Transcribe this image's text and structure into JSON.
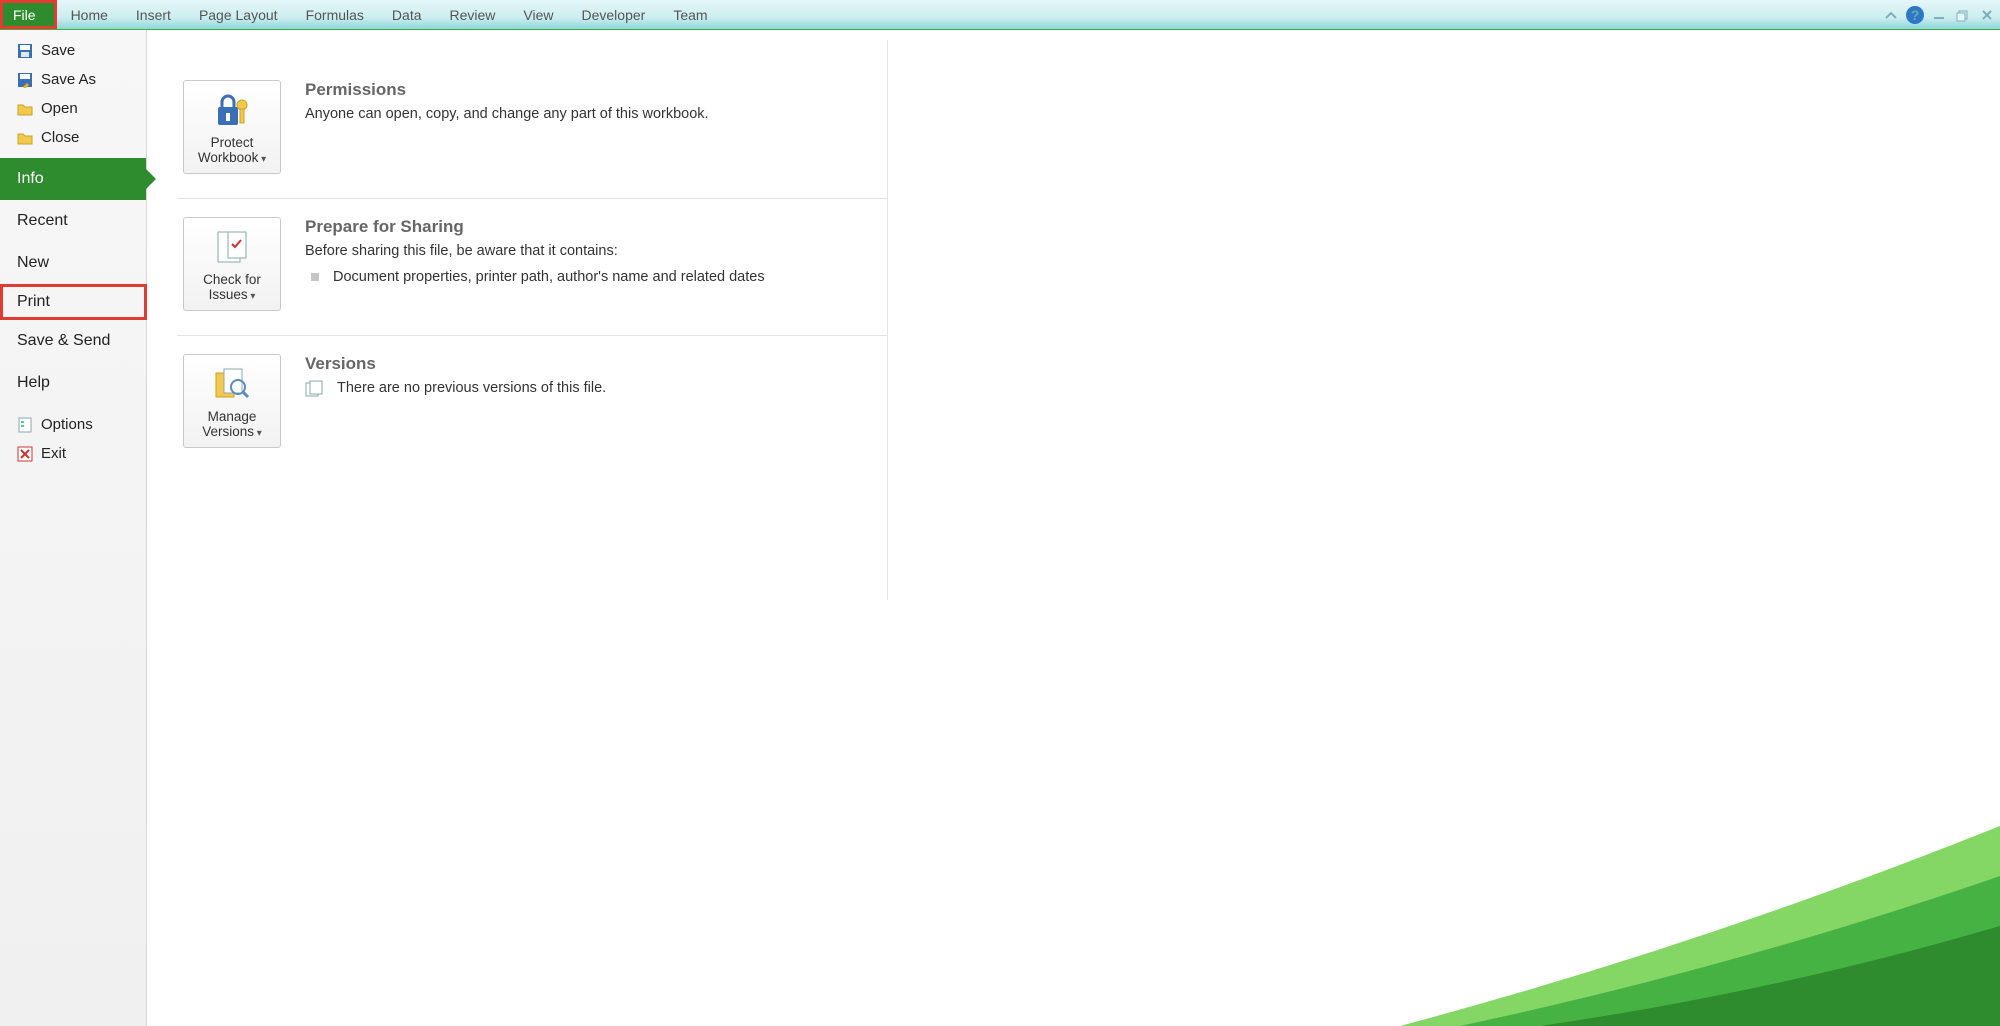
{
  "ribbon": {
    "tabs": [
      "File",
      "Home",
      "Insert",
      "Page Layout",
      "Formulas",
      "Data",
      "Review",
      "View",
      "Developer",
      "Team"
    ]
  },
  "sidebar": {
    "quick": [
      {
        "icon": "save-icon",
        "label": "Save"
      },
      {
        "icon": "save-as-icon",
        "label": "Save As"
      },
      {
        "icon": "open-icon",
        "label": "Open"
      },
      {
        "icon": "close-icon",
        "label": "Close"
      }
    ],
    "major": [
      "Info",
      "Recent",
      "New",
      "Print",
      "Save & Send",
      "Help"
    ],
    "footer": [
      {
        "icon": "options-icon",
        "label": "Options"
      },
      {
        "icon": "exit-icon",
        "label": "Exit"
      }
    ],
    "active": "Info",
    "highlighted": "Print"
  },
  "content": {
    "permissions": {
      "title": "Permissions",
      "body": "Anyone can open, copy, and change any part of this workbook.",
      "button_line1": "Protect",
      "button_line2": "Workbook"
    },
    "prepare": {
      "title": "Prepare for Sharing",
      "body": "Before sharing this file, be aware that it contains:",
      "bullet": "Document properties, printer path, author's name and related dates",
      "button_line1": "Check for",
      "button_line2": "Issues"
    },
    "versions": {
      "title": "Versions",
      "body": "There are no previous versions of this file.",
      "button_line1": "Manage",
      "button_line2": "Versions"
    }
  }
}
